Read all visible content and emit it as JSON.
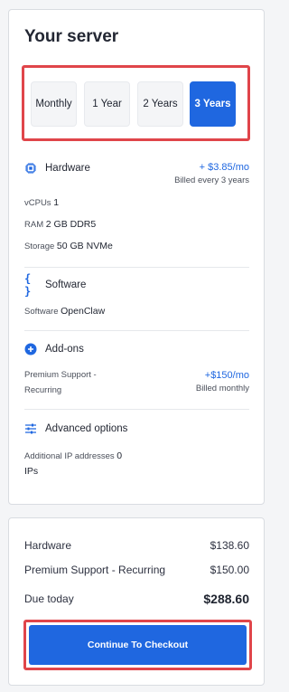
{
  "server": {
    "title": "Your server",
    "periods": [
      {
        "label": "Monthly",
        "selected": false
      },
      {
        "label": "1 Year",
        "selected": false
      },
      {
        "label": "2 Years",
        "selected": false
      },
      {
        "label": "3 Years",
        "selected": true
      }
    ]
  },
  "hardware": {
    "title": "Hardware",
    "price": "+ $3.85/mo",
    "billing": "Billed every 3 years",
    "vcpu_label": "vCPUs",
    "vcpu_value": "1",
    "ram_label": "RAM",
    "ram_value": "2 GB DDR5",
    "storage_label": "Storage",
    "storage_value": "50 GB NVMe"
  },
  "software": {
    "title": "Software",
    "label": "Software",
    "value": "OpenClaw"
  },
  "addons": {
    "title": "Add-ons",
    "item_line1": "Premium Support -",
    "item_line2": "Recurring",
    "price": "+$150/mo",
    "billing": "Billed monthly"
  },
  "advanced": {
    "title": "Advanced options",
    "ip_label": "Additional IP addresses",
    "ip_value": "0",
    "ip_unit": "IPs"
  },
  "summary": {
    "hardware_label": "Hardware",
    "hardware_value": "$138.60",
    "support_label": "Premium Support - Recurring",
    "support_value": "$150.00",
    "due_label": "Due today",
    "due_value": "$288.60",
    "checkout_label": "Continue To Checkout"
  },
  "colors": {
    "accent": "#1f67e0",
    "highlight": "#e0454a"
  }
}
